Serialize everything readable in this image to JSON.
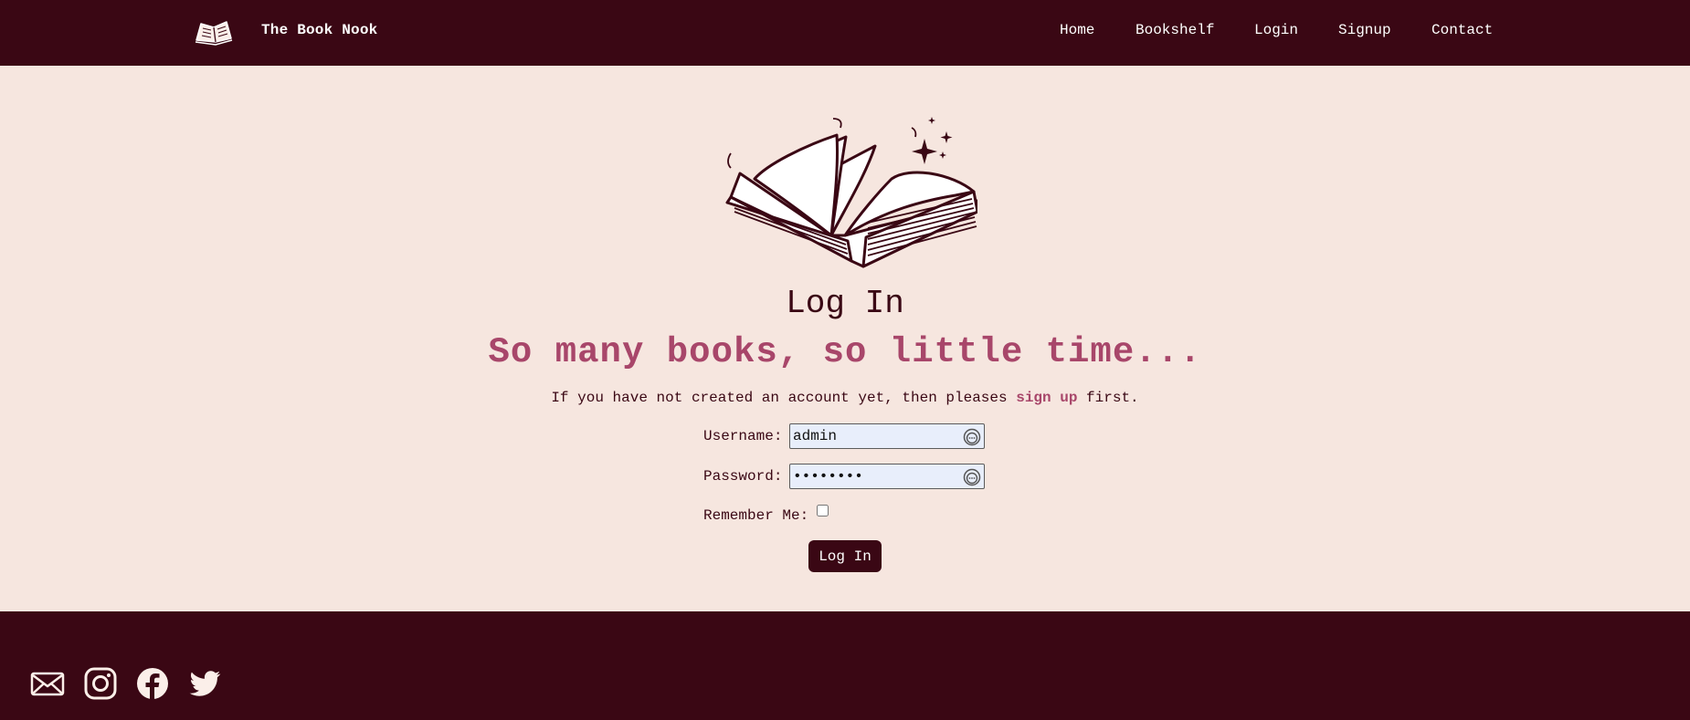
{
  "header": {
    "brand": "The Book Nook",
    "logo_icon": "open-book-icon",
    "nav": [
      "Home",
      "Bookshelf",
      "Login",
      "Signup",
      "Contact"
    ]
  },
  "main": {
    "illustration_icon": "open-book-sparkles-illustration",
    "title": "Log In",
    "tagline": "So many books, so little time...",
    "note": {
      "before": "If you have not created an account yet, then pleases ",
      "link": "sign up",
      "after": " first."
    },
    "form": {
      "username_label": "Username:",
      "username_value": "admin",
      "password_label": "Password:",
      "password_value": "••••••••",
      "remember_label": "Remember Me:",
      "remember_checked": false,
      "submit_label": "Log In",
      "autofill_icon": "password-manager-icon"
    }
  },
  "footer": {
    "social_icons": [
      "mail-icon",
      "instagram-icon",
      "facebook-icon",
      "twitter-icon"
    ]
  },
  "colors": {
    "primary": "#3a0714",
    "background": "#f6e6df",
    "accent": "#a8466a",
    "input_bg": "#e8eefb"
  }
}
